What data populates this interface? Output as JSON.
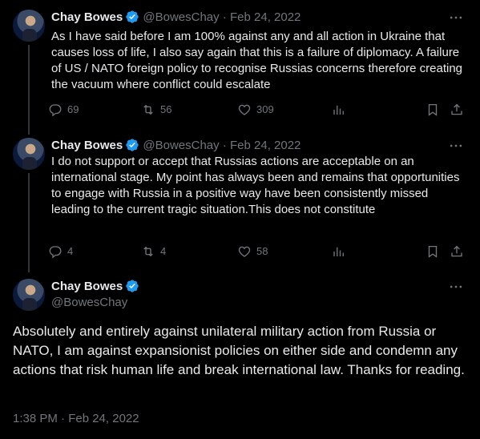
{
  "tweets": [
    {
      "name": "Chay Bowes",
      "handle": "@BowesChay",
      "separator": "·",
      "date": "Feb 24, 2022",
      "text": "As I have said before I am 100% against any and all action in Ukraine that causes loss of life, I also say again that this is a failure of diplomacy. A failure of US / NATO foreign policy to recognise Russias concerns therefore creating the vacuum where conflict could escalate",
      "replies": "69",
      "reposts": "56",
      "likes": "309"
    },
    {
      "name": "Chay Bowes",
      "handle": "@BowesChay",
      "separator": "·",
      "date": "Feb 24, 2022",
      "text": "I do not support or accept that Russias actions are acceptable on an international stage. My point has always been and remains that opportunities to engage with Russia in a positive way have been consistently missed leading to the current tragic situation.This does not constitute",
      "replies": "4",
      "reposts": "4",
      "likes": "58"
    }
  ],
  "main_tweet": {
    "name": "Chay Bowes",
    "handle": "@BowesChay",
    "text": "Absolutely and entirely against unilateral military action from Russia or NATO, I am against expansionist policies on either side and condemn any actions that risk human life and break international law. Thanks for reading.",
    "timestamp": "1:38 PM · Feb 24, 2022"
  },
  "colors": {
    "background": "#000000",
    "text": "#e7e9ea",
    "muted": "#71767b",
    "verified": "#1d9bf0"
  },
  "icons": [
    "verified-badge-icon",
    "more-icon",
    "reply-icon",
    "repost-icon",
    "like-icon",
    "views-icon",
    "bookmark-icon",
    "share-icon"
  ]
}
